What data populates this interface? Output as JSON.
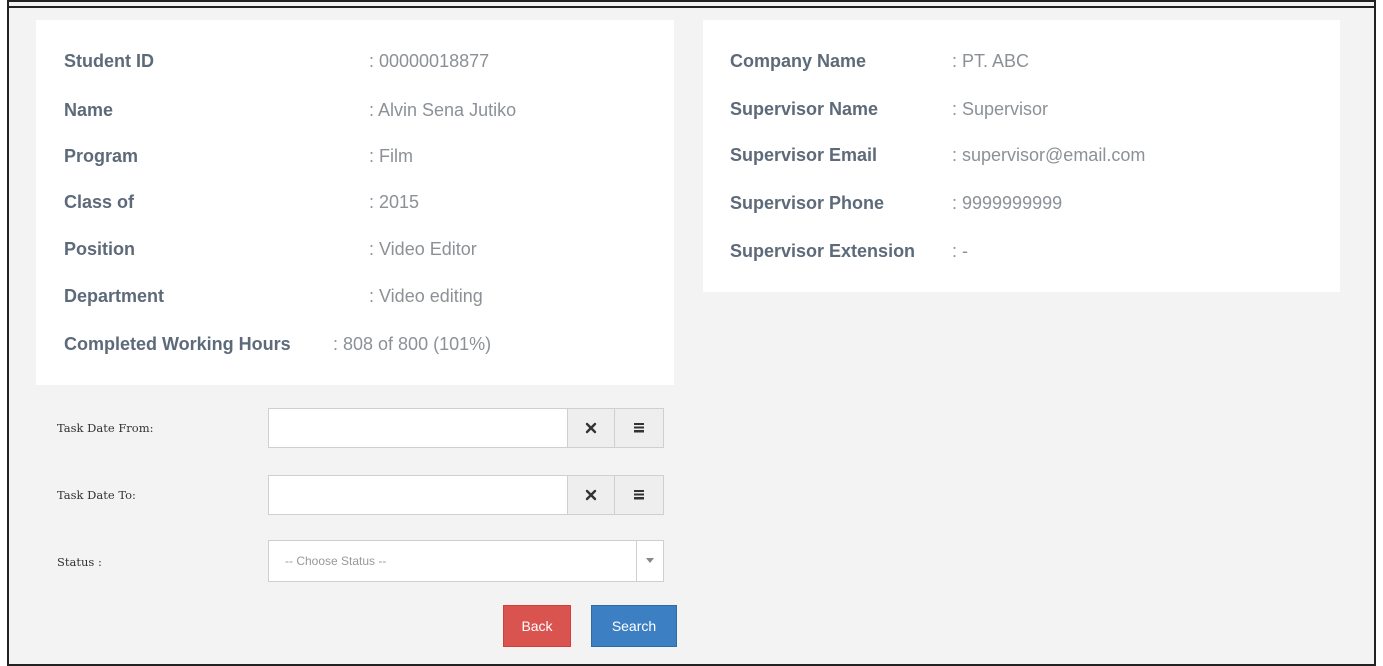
{
  "student_info": {
    "student_id_label": "Student ID",
    "student_id_value": ": 00000018877",
    "name_label": "Name",
    "name_value": ": Alvin Sena Jutiko",
    "program_label": "Program",
    "program_value": ": Film",
    "class_label": "Class of",
    "class_value": ": 2015",
    "position_label": "Position",
    "position_value": ": Video Editor",
    "department_label": "Department",
    "department_value": ": Video editing",
    "hours_label": "Completed Working Hours",
    "hours_value": ": 808 of 800 (101%)",
    "hours_progress_percent": 101
  },
  "company_info": {
    "company_label": "Company Name",
    "company_value": ": PT. ABC",
    "supervisor_name_label": "Supervisor Name",
    "supervisor_name_value": ": Supervisor",
    "supervisor_email_label": "Supervisor Email",
    "supervisor_email_value": ": supervisor@email.com",
    "supervisor_phone_label": "Supervisor Phone",
    "supervisor_phone_value": ": 9999999999",
    "supervisor_ext_label": "Supervisor Extension",
    "supervisor_ext_value": ": -"
  },
  "filters": {
    "date_from_label": "Task Date From:",
    "date_from_value": "",
    "date_to_label": "Task Date To:",
    "date_to_value": "",
    "status_label": "Status :",
    "status_selected": "-- Choose Status --",
    "clear_icon": "close-icon",
    "calendar_icon": "calendar-icon"
  },
  "actions": {
    "back_label": "Back",
    "search_label": "Search"
  },
  "colors": {
    "back_button": "#d9534f",
    "search_button": "#3c7fc3",
    "label_text": "#5d6a79",
    "value_text": "#8b9197"
  }
}
